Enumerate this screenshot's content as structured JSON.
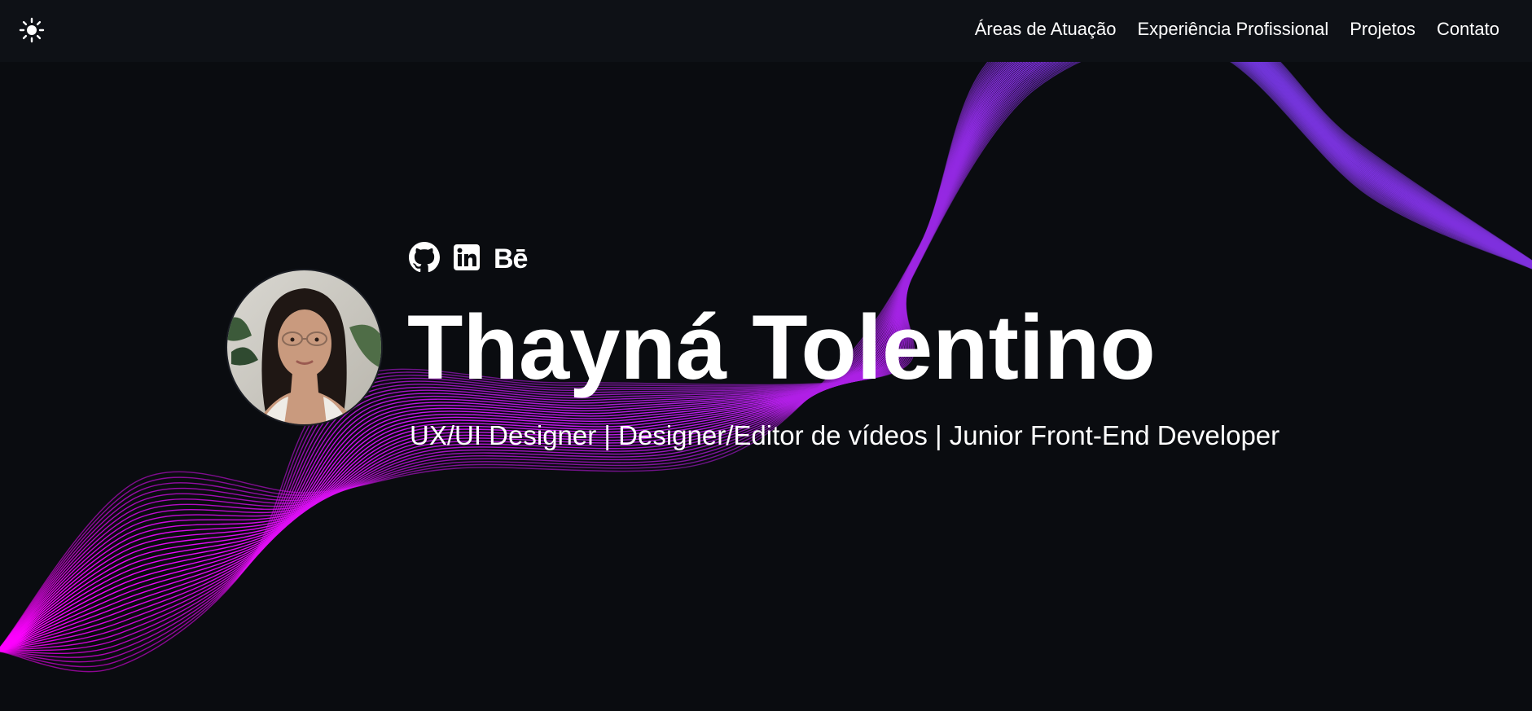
{
  "header": {
    "theme_toggle_icon": "sun-icon",
    "nav": [
      {
        "label": "Áreas de Atuação"
      },
      {
        "label": "Experiência Profissional"
      },
      {
        "label": "Projetos"
      },
      {
        "label": "Contato"
      }
    ]
  },
  "hero": {
    "name": "Thayná Tolentino",
    "tagline": "UX/UI Designer | Designer/Editor de vídeos | Junior Front-End Developer",
    "avatar_icon": "profile-photo",
    "social": [
      {
        "icon": "github-icon"
      },
      {
        "icon": "linkedin-icon"
      },
      {
        "icon": "behance-icon",
        "text": "Bē"
      }
    ]
  },
  "colors": {
    "background": "#0a0c10",
    "navbar": "#0e1116",
    "text": "#ffffff",
    "wave_magenta": "#ff00ff",
    "wave_purple": "#9b30e8",
    "wave_blue": "#5a3fd6"
  }
}
